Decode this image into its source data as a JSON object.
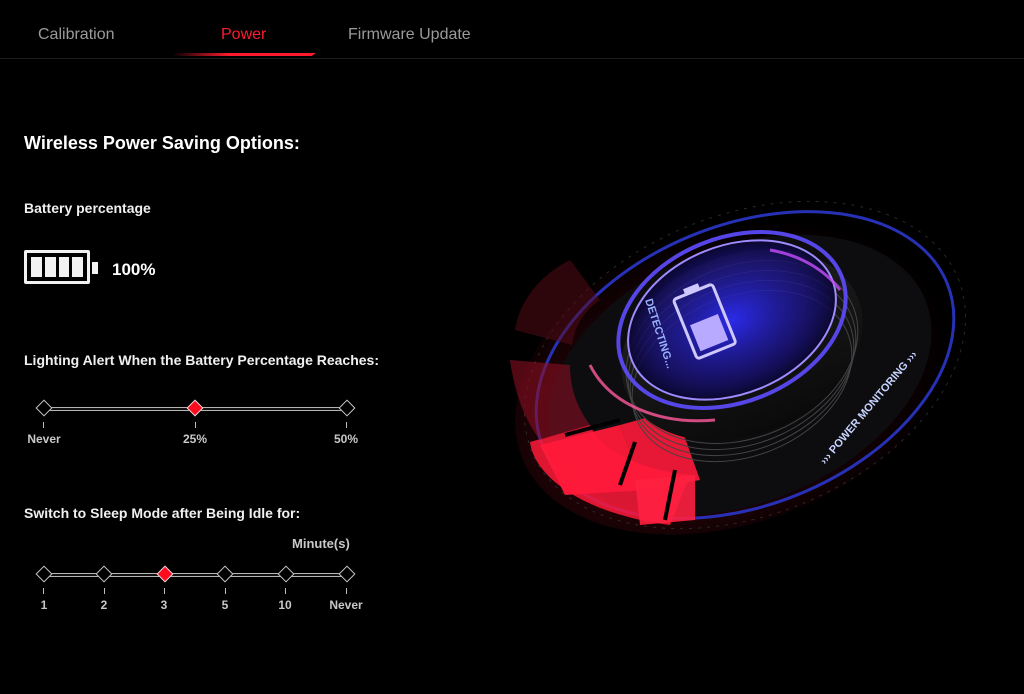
{
  "tabs": [
    {
      "label": "Calibration"
    },
    {
      "label": "Power"
    },
    {
      "label": "Firmware Update"
    }
  ],
  "active_tab": "Power",
  "accent_color": "#ff1a2e",
  "section_title": "Wireless Power Saving Options:",
  "battery": {
    "label": "Battery percentage",
    "value_text": "100%",
    "level": 1.0
  },
  "lighting_alert": {
    "label": "Lighting Alert When the Battery Percentage Reaches:",
    "options": [
      "Never",
      "25%",
      "50%"
    ],
    "selected": "25%"
  },
  "sleep_mode": {
    "label": "Switch to Sleep Mode after Being Idle for:",
    "unit": "Minute(s)",
    "options": [
      "1",
      "2",
      "3",
      "5",
      "10",
      "Never"
    ],
    "selected": "3"
  },
  "illustration": {
    "detecting_text": "DETECTING...",
    "ring_text": "››› POWER MONITORING ›››",
    "icon": "battery-icon"
  }
}
